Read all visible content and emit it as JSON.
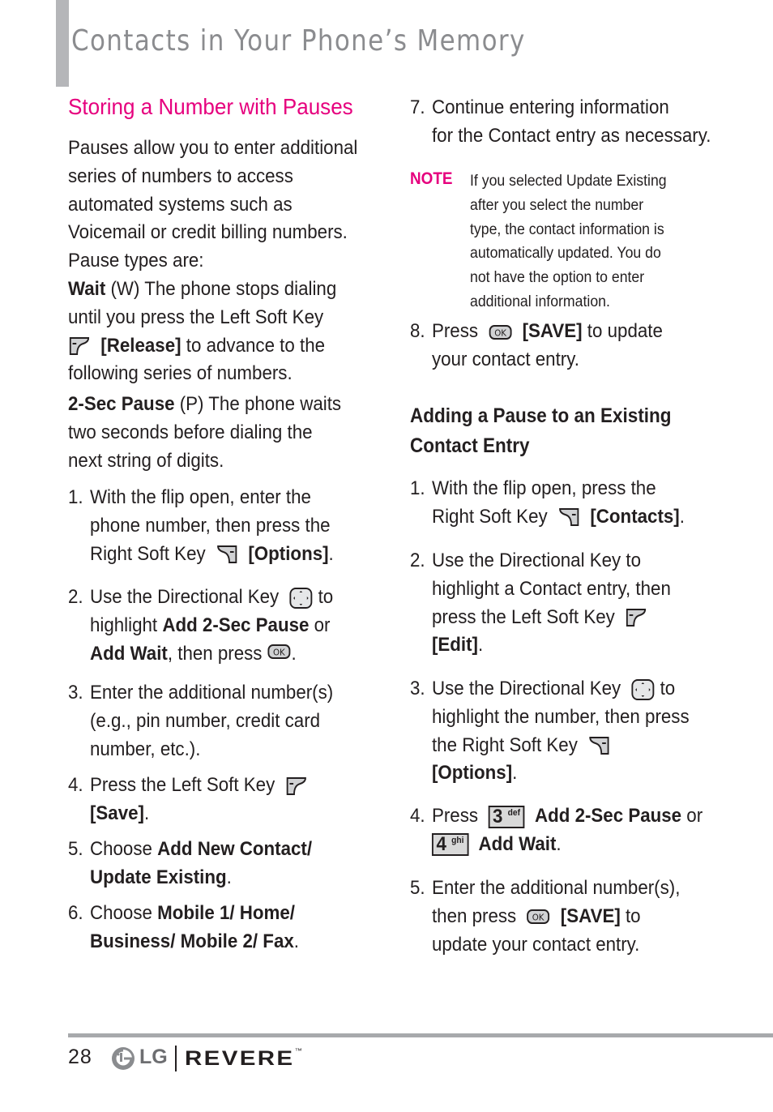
{
  "header": {
    "title": "Contacts in Your Phone’s Memory"
  },
  "left": {
    "section_title": "Storing a Number with Pauses",
    "intro": [
      "Pauses allow you to enter additional",
      "series of numbers to access",
      "automated systems such as",
      "Voicemail or credit billing numbers.",
      "Pause types are:"
    ],
    "wait": {
      "term": "Wait",
      "code": " (W) The",
      "l1_rest": " phone stops dialing",
      "l2": "until you press the Left Soft Key",
      "l3_bold": "[Release]",
      "l3_rest": " to advance to the",
      "l4": "following series of numbers."
    },
    "pause": {
      "term": "2-Sec Pause",
      "code": " (P)",
      "l1_rest": " The phone waits",
      "l2": "two seconds before dialing the",
      "l3": "next string of digits."
    },
    "steps": {
      "s1": {
        "num": "1.",
        "a": "With the flip open, enter the",
        "b": "phone number, then press the",
        "c": "Right Soft Key",
        "c_bold": "[Options]",
        "c_end": "."
      },
      "s2": {
        "num": "2.",
        "a": "Use the Directional Key",
        "a_end": " to",
        "b": "highlight ",
        "b_bold": "Add 2-Sec Pause",
        "b_end": " or",
        "c_bold": "Add Wait",
        "c": ", then press",
        "c_end": "."
      },
      "s3": {
        "num": "3.",
        "a": "Enter the additional number(s)",
        "b": "(e.g., pin number, credit card",
        "c": "number, etc.)."
      },
      "s4": {
        "num": "4.",
        "a": "Press the Left Soft Key",
        "b_bold": "[Save]",
        "b_end": "."
      },
      "s5": {
        "num": "5.",
        "a": "Choose ",
        "a_bold": "Add New Contact/",
        "b_bold": "Update Existing",
        "b_end": "."
      },
      "s6": {
        "num": "6.",
        "a": "Choose ",
        "a_bold": "Mobile 1/ Home/",
        "b_bold": "Business/ Mobile 2/ Fax",
        "b_end": "."
      }
    }
  },
  "right": {
    "s7": {
      "num": "7.",
      "a": "Continue entering information",
      "b": "for the Contact entry as necessary."
    },
    "note": {
      "label": "NOTE",
      "lines": [
        "If you selected Update Existing",
        "after you select the number",
        "type, the contact information is",
        "automatically updated. You do",
        "not have the option to enter",
        "additional information."
      ]
    },
    "s8": {
      "num": "8.",
      "a": "Press",
      "a_bold": "[SAVE]",
      "a_end": " to update",
      "b": "your contact entry."
    },
    "subheading": [
      "Adding a Pause to an Existing",
      "Contact Entry"
    ],
    "steps": {
      "s1": {
        "num": "1.",
        "a": "With the flip open, press the",
        "b": "Right Soft Key",
        "b_bold": "[Contacts]",
        "b_end": "."
      },
      "s2": {
        "num": "2.",
        "a": "Use the Directional Key to",
        "b": "highlight a Contact entry, then",
        "c": "press the Left Soft Key",
        "d_bold": "[Edit]",
        "d_end": "."
      },
      "s3": {
        "num": "3.",
        "a": "Use the Directional Key",
        "a_end": " to",
        "b": "highlight the number, then press",
        "c": "the Right Soft Key",
        "d_bold": "[Options]",
        "d_end": "."
      },
      "s4": {
        "num": "4.",
        "a": "Press",
        "key1_digit": "3",
        "key1_letters": "def",
        "a_bold": "Add 2-Sec Pause",
        "a_end": " or",
        "key2_digit": "4",
        "key2_letters": "ghi",
        "b_bold": "Add Wait",
        "b_end": "."
      },
      "s5": {
        "num": "5.",
        "a": "Enter the additional number(s),",
        "b": "then press",
        "b_bold": "[SAVE]",
        "b_end": " to",
        "c": "update your contact entry."
      }
    }
  },
  "footer": {
    "page_number": "28",
    "lg_text": "LG",
    "brand": "REVERE",
    "tm": "™"
  },
  "colors": {
    "accent": "#e6007e",
    "title_gray": "#8b8c8f",
    "bar_gray": "#b5b6b9"
  }
}
